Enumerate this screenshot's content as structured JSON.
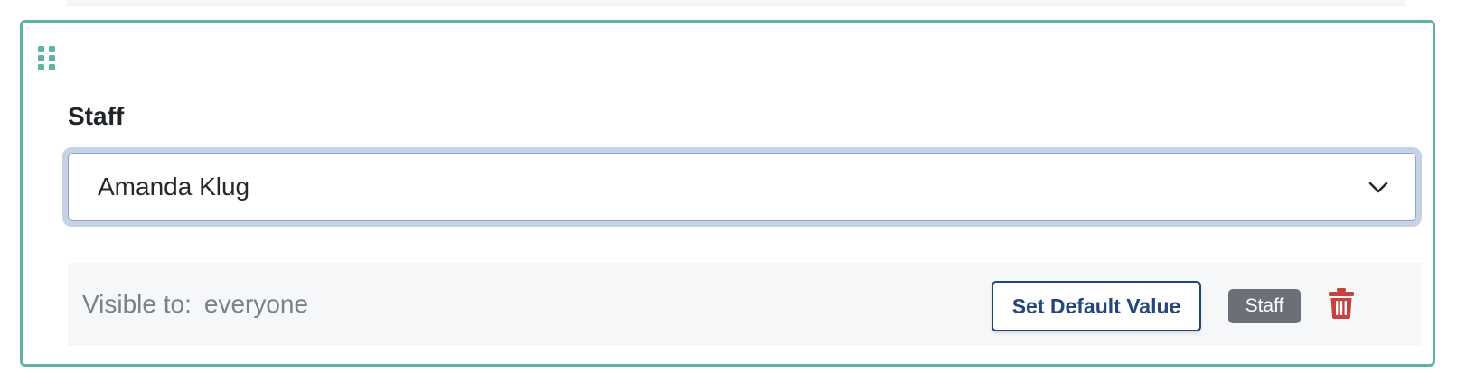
{
  "field": {
    "label": "Staff",
    "selected_value": "Amanda Klug"
  },
  "footer": {
    "visible_to_label": "Visible to:",
    "visible_to_value": "everyone",
    "set_default_button": "Set Default Value",
    "badge": "Staff"
  },
  "icons": {
    "drag": "drag-handle-icon",
    "dropdown": "chevron-down-icon",
    "delete": "trash-icon"
  },
  "colors": {
    "card_border": "#5fb3a5",
    "drag_handle": "#5fb3a5",
    "button_primary": "#24467d",
    "badge_bg": "#6b7078",
    "delete": "#c8413f",
    "select_focus_ring": "#c6d2e6"
  }
}
